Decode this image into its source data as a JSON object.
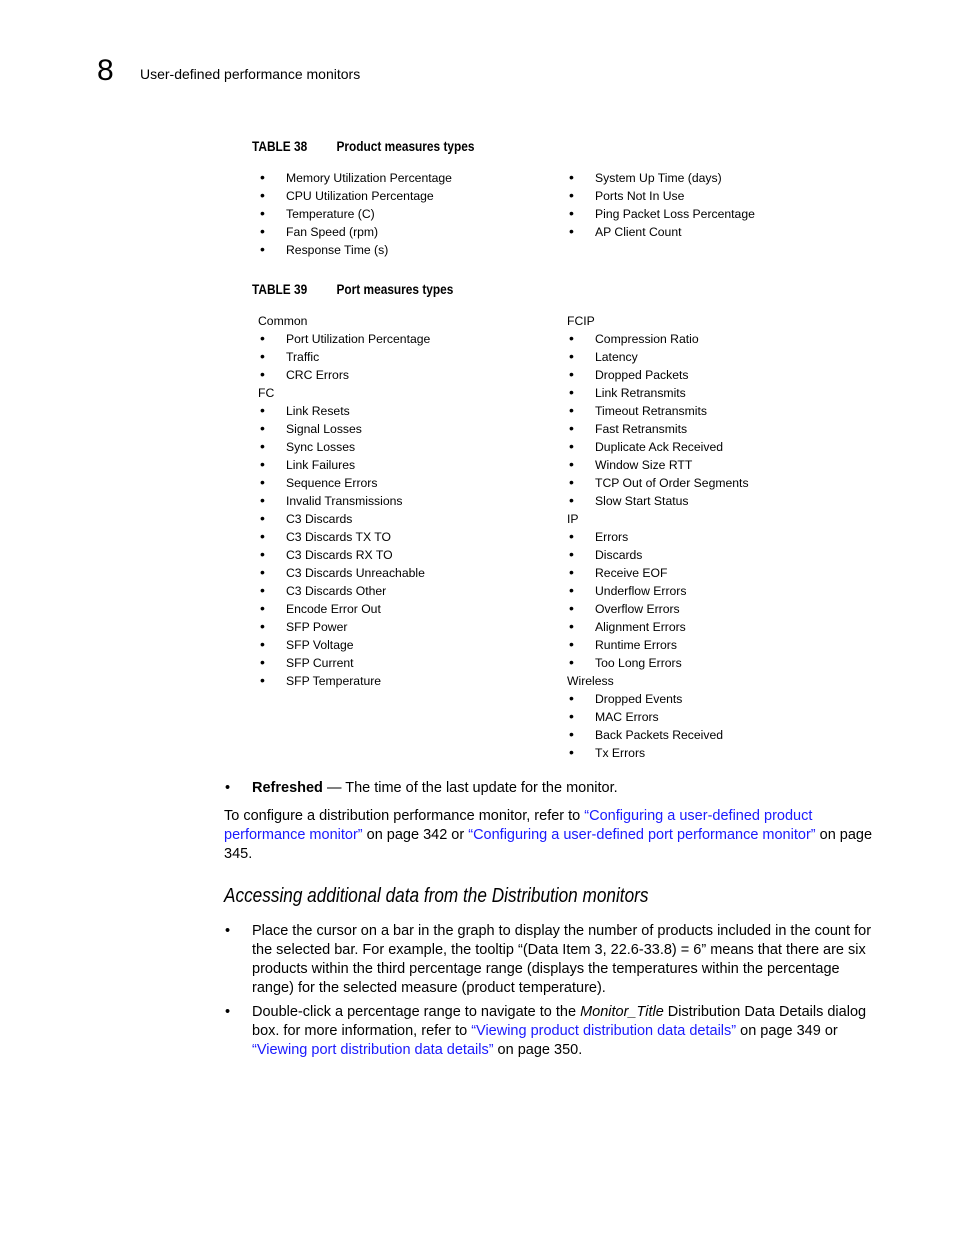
{
  "header": {
    "chapter_number": "8",
    "chapter_title": "User-defined performance monitors"
  },
  "table38": {
    "label": "TABLE 38",
    "title": "Product measures types",
    "left_items": [
      "Memory Utilization Percentage",
      "CPU Utilization Percentage",
      "Temperature (C)",
      "Fan Speed (rpm)",
      "Response Time (s)"
    ],
    "right_items": [
      "System Up Time (days)",
      "Ports Not In Use",
      "Ping Packet Loss Percentage",
      "AP Client Count"
    ]
  },
  "table39": {
    "label": "TABLE 39",
    "title": "Port measures types",
    "left_rows": [
      {
        "type": "group",
        "text": "Common"
      },
      {
        "type": "item",
        "text": "Port Utilization Percentage"
      },
      {
        "type": "item",
        "text": "Traffic"
      },
      {
        "type": "item",
        "text": "CRC Errors"
      },
      {
        "type": "group",
        "text": "FC"
      },
      {
        "type": "item",
        "text": "Link Resets"
      },
      {
        "type": "item",
        "text": "Signal Losses"
      },
      {
        "type": "item",
        "text": "Sync Losses"
      },
      {
        "type": "item",
        "text": "Link Failures"
      },
      {
        "type": "item",
        "text": "Sequence Errors"
      },
      {
        "type": "item",
        "text": "Invalid Transmissions"
      },
      {
        "type": "item",
        "text": "C3 Discards"
      },
      {
        "type": "item",
        "text": "C3 Discards TX TO"
      },
      {
        "type": "item",
        "text": "C3 Discards RX TO"
      },
      {
        "type": "item",
        "text": "C3 Discards Unreachable"
      },
      {
        "type": "item",
        "text": "C3 Discards Other"
      },
      {
        "type": "item",
        "text": "Encode Error Out"
      },
      {
        "type": "item",
        "text": "SFP Power"
      },
      {
        "type": "item",
        "text": "SFP Voltage"
      },
      {
        "type": "item",
        "text": "SFP Current"
      },
      {
        "type": "item",
        "text": "SFP Temperature"
      }
    ],
    "right_rows": [
      {
        "type": "group",
        "text": "FCIP"
      },
      {
        "type": "item",
        "text": "Compression Ratio"
      },
      {
        "type": "item",
        "text": "Latency"
      },
      {
        "type": "item",
        "text": "Dropped Packets"
      },
      {
        "type": "item",
        "text": "Link Retransmits"
      },
      {
        "type": "item",
        "text": "Timeout Retransmits"
      },
      {
        "type": "item",
        "text": "Fast Retransmits"
      },
      {
        "type": "item",
        "text": "Duplicate Ack Received"
      },
      {
        "type": "item",
        "text": "Window Size RTT"
      },
      {
        "type": "item",
        "text": "TCP Out of Order Segments"
      },
      {
        "type": "item",
        "text": "Slow Start Status"
      },
      {
        "type": "group",
        "text": "IP"
      },
      {
        "type": "item",
        "text": "Errors"
      },
      {
        "type": "item",
        "text": "Discards"
      },
      {
        "type": "item",
        "text": "Receive EOF"
      },
      {
        "type": "item",
        "text": "Underflow Errors"
      },
      {
        "type": "item",
        "text": "Overflow Errors"
      },
      {
        "type": "item",
        "text": "Alignment Errors"
      },
      {
        "type": "item",
        "text": "Runtime Errors"
      },
      {
        "type": "item",
        "text": "Too Long Errors"
      },
      {
        "type": "group",
        "text": "Wireless"
      },
      {
        "type": "item",
        "text": "Dropped Events"
      },
      {
        "type": "item",
        "text": "MAC Errors"
      },
      {
        "type": "item",
        "text": "Back Packets Received"
      },
      {
        "type": "item",
        "text": "Tx Errors"
      }
    ]
  },
  "refreshed": {
    "term": "Refreshed",
    "desc": " — The time of the last update for the monitor."
  },
  "configure_para": {
    "t1": "To configure a distribution performance monitor, refer to ",
    "link1": "“Configuring a user-defined product performance monitor”",
    "t2": " on page 342 or ",
    "link2": "“Configuring a user-defined port performance monitor”",
    "t3": " on page 345."
  },
  "section": {
    "heading": "Accessing additional data from the Distribution monitors",
    "bullet1": "Place the cursor on a bar in the graph to display the number of products included in the count for the selected bar. For example, the tooltip “(Data Item 3, 22.6-33.8) = 6” means that there are six products within the third percentage range (displays the temperatures within the percentage range) for the selected measure (product temperature).",
    "bullet2": {
      "t1": "Double-click a percentage range to navigate to the ",
      "italic": "Monitor_Title",
      "bold": " Distribution Data Details",
      "t2": " dialog box. for more information, refer to ",
      "link1": "“Viewing product distribution data details”",
      "t3": " on page 349 or ",
      "link2": "“Viewing port distribution data details”",
      "t4": " on page 350."
    }
  },
  "colors": {
    "link": "#1a1aff",
    "text": "#000000"
  }
}
